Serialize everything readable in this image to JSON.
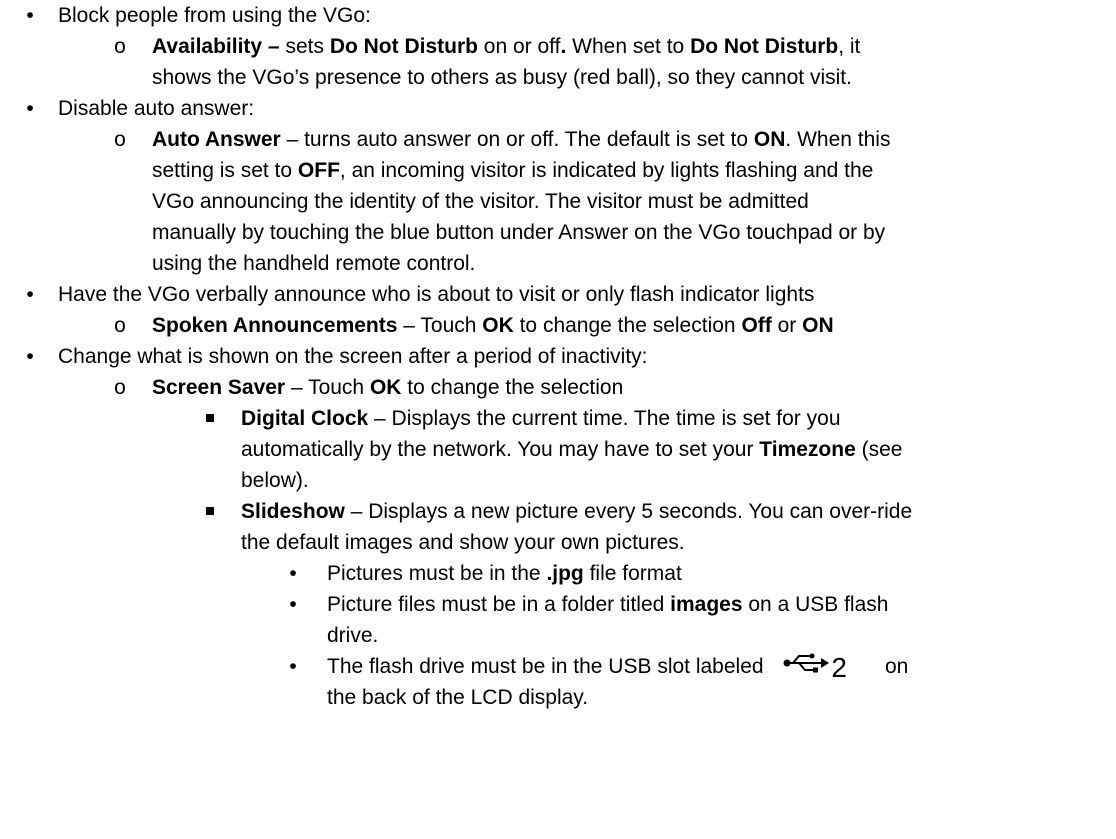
{
  "items": [
    {
      "text": "Block people from using the VGo:",
      "sub": {
        "b1": "Availability –",
        "t1": " sets ",
        "b2": "Do Not Disturb",
        "t2": " on or off",
        "b3": ".",
        "t3": "  When set to ",
        "b4": "Do Not Disturb",
        "t4": ", it",
        "cont": "shows the VGo’s presence to others as busy (red ball), so they cannot visit."
      }
    },
    {
      "text": "Disable auto answer:",
      "sub": {
        "b1": "Auto Answer",
        "t1": " – turns auto answer on or off.  The default is set to ",
        "b2": "ON",
        "t2": ".  When this",
        "l2a": "setting is set to ",
        "l2b": "OFF",
        "l2c": ", an incoming visitor is indicated by lights flashing and the",
        "l3": "VGo announcing the identity of the visitor.   The visitor must be admitted",
        "l4": "manually by touching the blue button under Answer on the VGo touchpad or by",
        "l5": "using the handheld remote control."
      }
    },
    {
      "text": "Have the VGo verbally announce who is about to visit or only flash indicator lights",
      "sub": {
        "b1": "Spoken Announcements",
        "t1": " – Touch ",
        "b2": "OK",
        "t2": " to change the selection ",
        "b3": "Off",
        "t3": " or ",
        "b4": "ON"
      }
    },
    {
      "text": "Change what is shown on the screen after a period of inactivity:",
      "sub": {
        "b1": "Screen Saver",
        "t1": " – Touch ",
        "b2": "OK",
        "t2": " to change the selection"
      },
      "clock": {
        "b1": "Digital Clock",
        "t1": " – Displays the current time.  The time is set for you",
        "l2": "automatically by the network.  You may have to set your ",
        "l2b": "Timezone",
        "l2c": " (see",
        "l3": "below)."
      },
      "slideshow": {
        "b1": "Slideshow",
        "t1": " – Displays a new picture every 5 seconds. You can over-ride",
        "l2": "the default images and show your own pictures.",
        "points": {
          "p1a": "Pictures must be in the ",
          "p1b": ".jpg",
          "p1c": "  file format",
          "p2a": "Picture files must be in a folder titled ",
          "p2b": "images",
          "p2c": " on a USB flash",
          "p2d": "drive.",
          "p3a": "The flash drive must be in the USB slot labeled",
          "p3num": "2",
          "p3b": "on",
          "p3c": "the back of the LCD display."
        }
      }
    }
  ],
  "glyphs": {
    "bullet": "•",
    "circle": "o",
    "usb_icon": "usb-icon"
  }
}
